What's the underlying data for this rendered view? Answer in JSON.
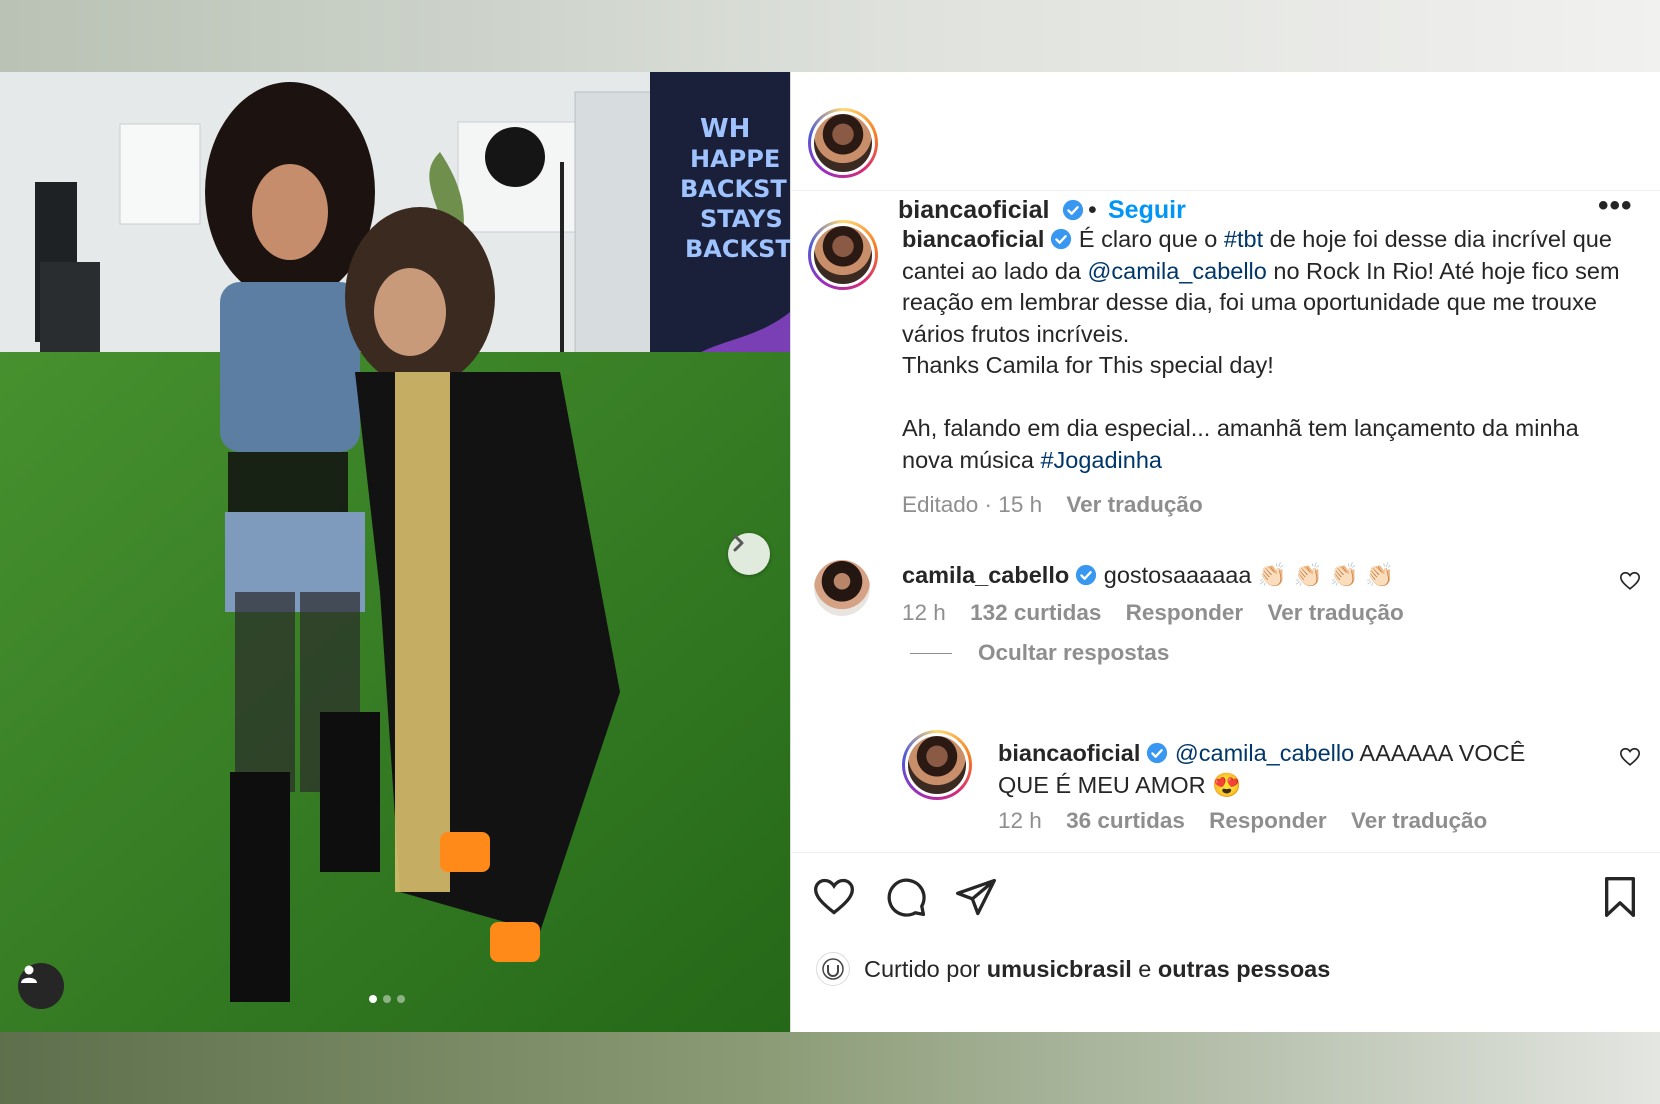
{
  "post": {
    "author": "biancaoficial",
    "separator": "•",
    "follow_label": "Seguir",
    "more_label": "•••",
    "carousel": {
      "current": 1,
      "total": 3
    }
  },
  "caption": {
    "author": "biancaoficial",
    "text_1": "É claro que o ",
    "hashtag_1": "#tbt",
    "text_2": " de hoje foi desse dia incrível que cantei ao lado da ",
    "mention_1": "@camila_cabello",
    "text_3": " no Rock In Rio! Até hoje fico sem reação em lembrar desse dia, foi uma oportunidade que me trouxe vários frutos incríveis.",
    "text_4": "Thanks Camila for This special day!",
    "text_5": "Ah, falando em dia especial... amanhã tem lançamento da minha nova música ",
    "hashtag_2": "#Jogadinha",
    "edited": "Editado · 15 h",
    "translate": "Ver tradução"
  },
  "comments": [
    {
      "author": "camila_cabello",
      "text": "gostosaaaaaa 👏🏻 👏🏻 👏🏻 👏🏻",
      "time": "12 h",
      "likes": "132 curtidas",
      "reply": "Responder",
      "translate": "Ver tradução"
    }
  ],
  "hide_replies": "Ocultar respostas",
  "reply": {
    "author": "biancaoficial",
    "mention": "@camila_cabello",
    "text": " AAAAAA VOCÊ QUE É MEU AMOR 😍",
    "time": "12 h",
    "likes": "36 curtidas",
    "reply": "Responder",
    "translate": "Ver tradução"
  },
  "liked_by": {
    "prefix": "Curtido por ",
    "user": "umusicbrasil",
    "middle": " e ",
    "others": "outras pessoas"
  },
  "colors": {
    "link": "#00376b",
    "follow": "#0095f6",
    "verified": "#3897f0",
    "muted": "#8e8e8e"
  }
}
